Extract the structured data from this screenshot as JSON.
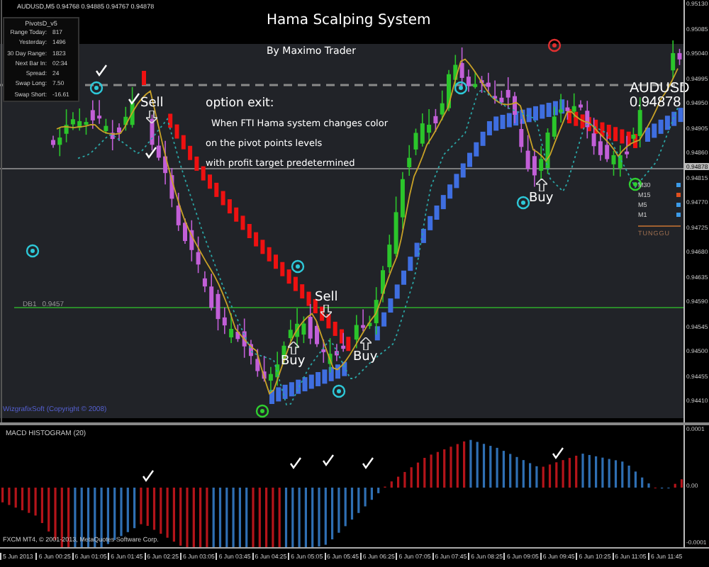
{
  "window": {
    "title": "AUDUSD,M5  0.94768 0.94885 0.94767 0.94878"
  },
  "pivot_panel": {
    "title": "PivotsD_v5",
    "rows": [
      {
        "label": "Range Today:",
        "value": "817"
      },
      {
        "label": "Yesterday:",
        "value": "1496"
      },
      {
        "label": "30 Day Range:",
        "value": "1823"
      },
      {
        "label": "Next Bar In:",
        "value": "02:34"
      },
      {
        "label": "Spread:",
        "value": "24"
      },
      {
        "label": "Swap Long:",
        "value": "7.50"
      },
      {
        "label": "Swap Short:",
        "value": "-16.61"
      }
    ]
  },
  "chart": {
    "title": "Hama Scalping System",
    "author": "By Maximo Trader",
    "note_heading": "option exit:",
    "note_lines": [
      "When FTI Hama system changes  color",
      "on the pivot points levels",
      "with profit target predetermined"
    ],
    "signals": [
      {
        "kind": "sell",
        "label": "Sell"
      },
      {
        "kind": "sell",
        "label": "Sell"
      },
      {
        "kind": "buy",
        "label": "Buy"
      },
      {
        "kind": "buy",
        "label": "Buy"
      },
      {
        "kind": "buy",
        "label": "Buy"
      }
    ],
    "level_line": {
      "label": "DB1",
      "value": "0.9457"
    },
    "credit": "WizgrafixSoft (Copyright © 2008)",
    "symbol": "AUDUSD",
    "price": "0.94878",
    "timeframes": [
      {
        "label": "M30",
        "color": "#3c9be8"
      },
      {
        "label": "M15",
        "color": "#e0501e"
      },
      {
        "label": "M5",
        "color": "#3c9be8"
      },
      {
        "label": "M1",
        "color": "#3c9be8"
      }
    ],
    "status": "TUNGGU",
    "price_scale": [
      "0.95130",
      "0.95085",
      "0.95040",
      "0.94995",
      "0.94950",
      "0.94905",
      "0.94860",
      "0.94815",
      "0.94770",
      "0.94725",
      "0.94680",
      "0.94635",
      "0.94590",
      "0.94545",
      "0.94500",
      "0.94455",
      "0.94410"
    ],
    "current_price": "0.94878"
  },
  "macd": {
    "title": "MACD HISTOGRAM (20)",
    "credit": "FXCM MT4, © 2001-2013, MetaQuotes Software Corp.",
    "scale": [
      "0.0001",
      "0.00",
      "-0.0001"
    ]
  },
  "time_axis": [
    "5 Jun 2013",
    "6 Jun 00:25",
    "6 Jun 01:05",
    "6 Jun 01:45",
    "6 Jun 02:25",
    "6 Jun 03:05",
    "6 Jun 03:45",
    "6 Jun 04:25",
    "6 Jun 05:05",
    "6 Jun 05:45",
    "6 Jun 06:25",
    "6 Jun 07:05",
    "6 Jun 07:45",
    "6 Jun 08:25",
    "6 Jun 09:05",
    "6 Jun 09:45",
    "6 Jun 10:25",
    "6 Jun 11:05",
    "6 Jun 11:45"
  ]
}
